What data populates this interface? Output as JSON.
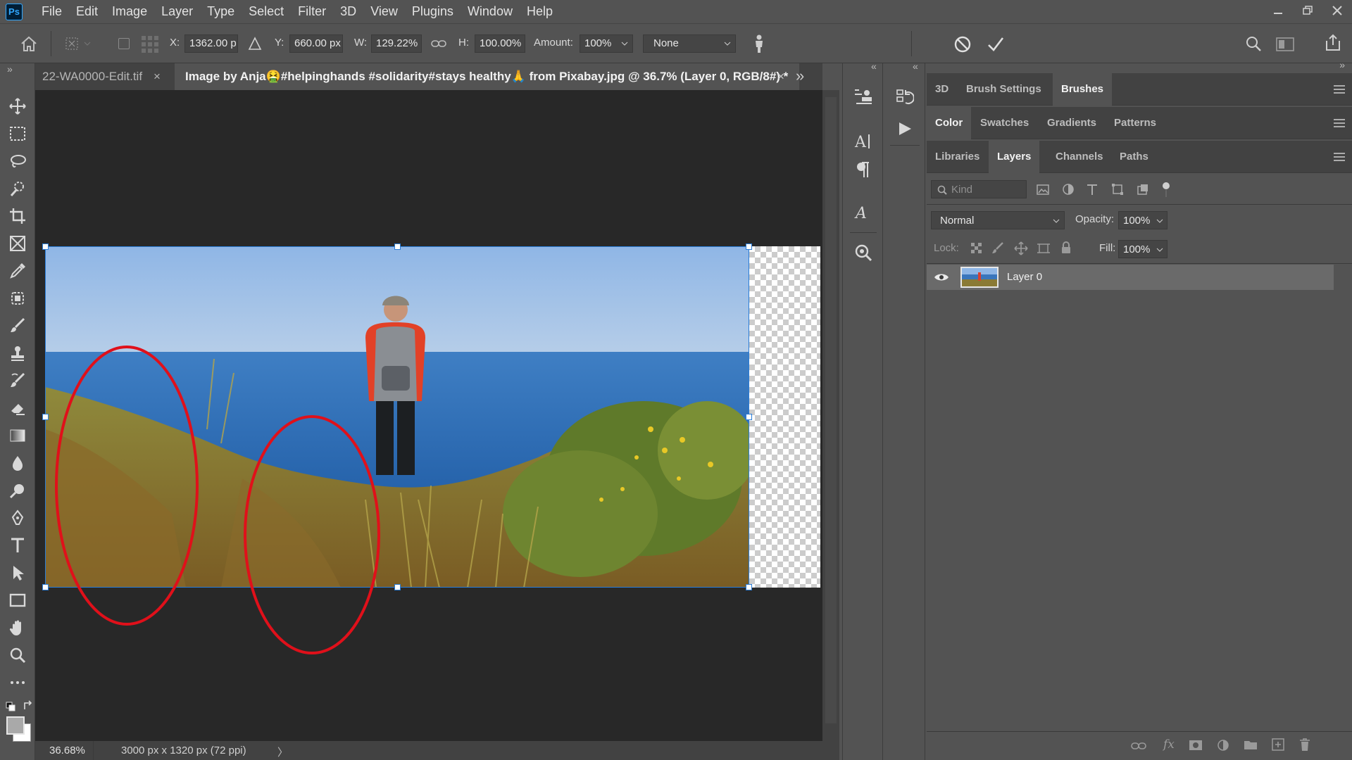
{
  "menubar": {
    "logo": "Ps",
    "items": [
      "File",
      "Edit",
      "Image",
      "Layer",
      "Type",
      "Select",
      "Filter",
      "3D",
      "View",
      "Plugins",
      "Window",
      "Help"
    ]
  },
  "options": {
    "x_label": "X:",
    "x_value": "1362.00 p",
    "y_label": "Y:",
    "y_value": "660.00 px",
    "w_label": "W:",
    "w_value": "129.22%",
    "h_label": "H:",
    "h_value": "100.00%",
    "amount_label": "Amount:",
    "amount_value": "100%",
    "interp_value": "None"
  },
  "tabs": {
    "inactive_label": "22-WA0000-Edit.tif",
    "active_label": "Image by Anja🤮#helpinghands #solidarity#stays healthy🙏 from Pixabay.jpg @ 36.7% (Layer 0, RGB/8#) *",
    "close_glyph": "×",
    "overflow": "»"
  },
  "status": {
    "zoom": "36.68%",
    "doc_size": "3000 px x 1320 px (72 ppi)",
    "arrow": "〉"
  },
  "panels": {
    "group1_tabs": [
      "3D",
      "Brush Settings",
      "Brushes"
    ],
    "group2_tabs": [
      "Color",
      "Swatches",
      "Gradients",
      "Patterns"
    ],
    "group3_tabs": [
      "Libraries",
      "Layers",
      "Channels",
      "Paths"
    ],
    "kind_placeholder": "Kind",
    "blend_mode": "Normal",
    "opacity_label": "Opacity:",
    "opacity_value": "100%",
    "lock_label": "Lock:",
    "fill_label": "Fill:",
    "fill_value": "100%",
    "layer_name": "Layer 0"
  },
  "colors": {
    "annotation": "#e0101a",
    "selection": "#2a7dd8"
  }
}
